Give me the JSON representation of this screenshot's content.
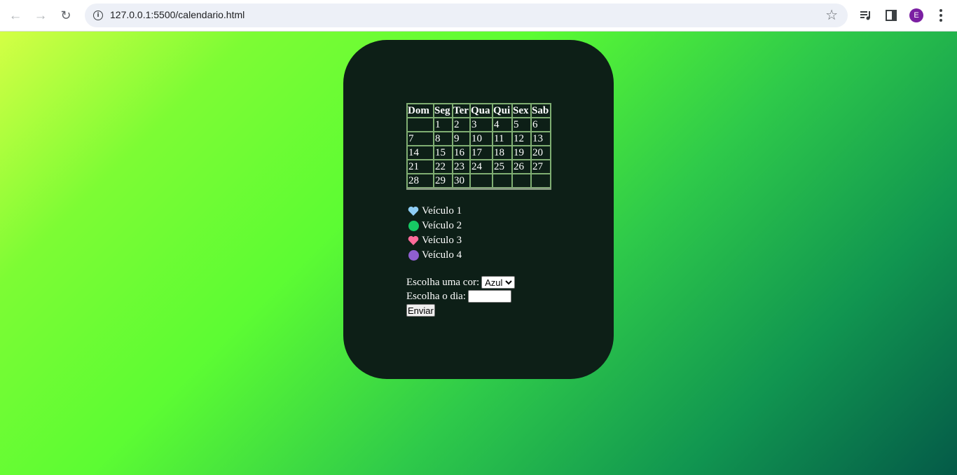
{
  "browser": {
    "url": "127.0.0.1:5500/calendario.html",
    "profile_initial": "E",
    "profile_color": "#7b1fa2"
  },
  "calendar": {
    "headers": [
      "Dom",
      "Seg",
      "Ter",
      "Qua",
      "Qui",
      "Sex",
      "Sab"
    ],
    "weeks": [
      [
        "",
        "1",
        "2",
        "3",
        "4",
        "5",
        "6"
      ],
      [
        "7",
        "8",
        "9",
        "10",
        "11",
        "12",
        "13"
      ],
      [
        "14",
        "15",
        "16",
        "17",
        "18",
        "19",
        "20"
      ],
      [
        "21",
        "22",
        "23",
        "24",
        "25",
        "26",
        "27"
      ],
      [
        "28",
        "29",
        "30",
        "",
        "",
        "",
        ""
      ]
    ]
  },
  "legend": [
    {
      "label": "Veículo 1",
      "icon": "blue-heart-icon",
      "color": "#8ecdf5"
    },
    {
      "label": "Veículo 2",
      "icon": "green-circle-icon",
      "color": "#17c964"
    },
    {
      "label": "Veículo 3",
      "icon": "pink-heart-icon",
      "color": "#ff6b9a"
    },
    {
      "label": "Veículo 4",
      "icon": "purple-circle-icon",
      "color": "#8f5fd0"
    }
  ],
  "form": {
    "color_label": "Escolha uma cor:",
    "color_selected": "Azul",
    "day_label": "Escolha o dia:",
    "day_value": "",
    "submit_label": "Enviar"
  }
}
